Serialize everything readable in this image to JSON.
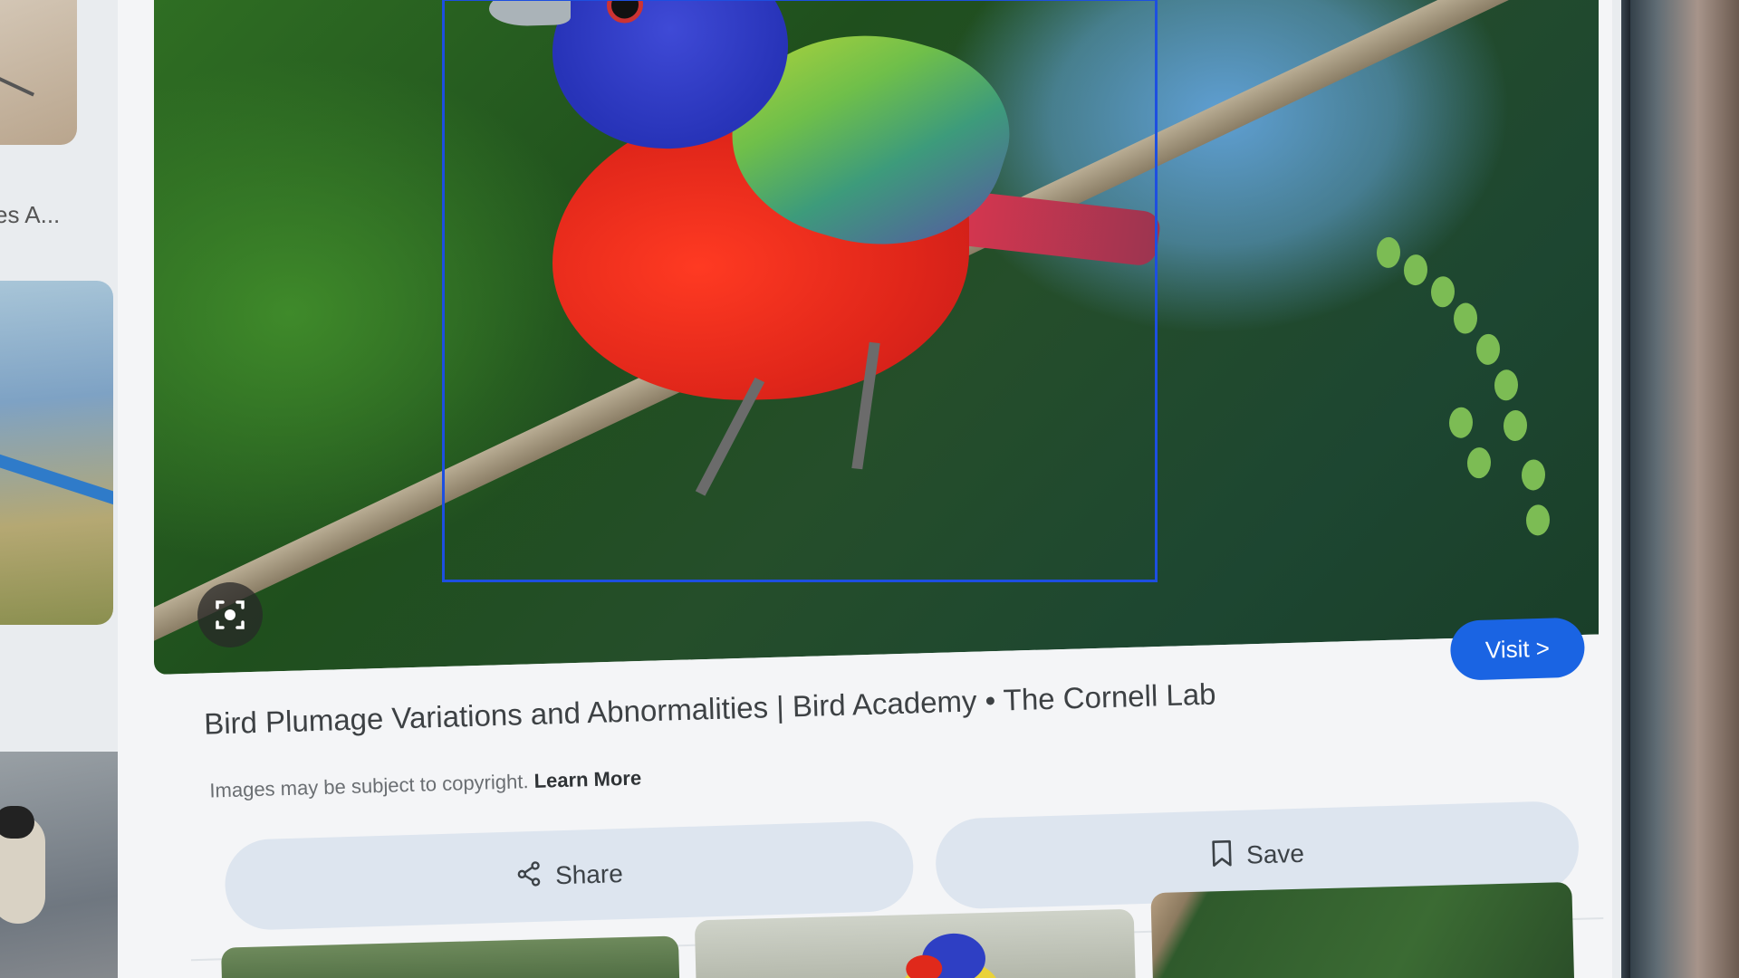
{
  "result": {
    "title": "Bird Plumage Variations and Abnormalities | Bird Academy • The Cornell Lab",
    "copyright_text": "Images may be subject to copyright.",
    "learn_more_label": "Learn More",
    "visit_label": "Visit >",
    "share_label": "Share",
    "save_label": "Save"
  },
  "sidebar": {
    "caption": "es A..."
  },
  "colors": {
    "accent": "#1a64e3",
    "selection_border": "#1d4fe0",
    "action_button_bg": "#dde5ef"
  },
  "icons": {
    "lens": "lens-icon",
    "share": "share-icon",
    "save": "bookmark-icon",
    "visit_chevron": "chevron-right-icon"
  }
}
